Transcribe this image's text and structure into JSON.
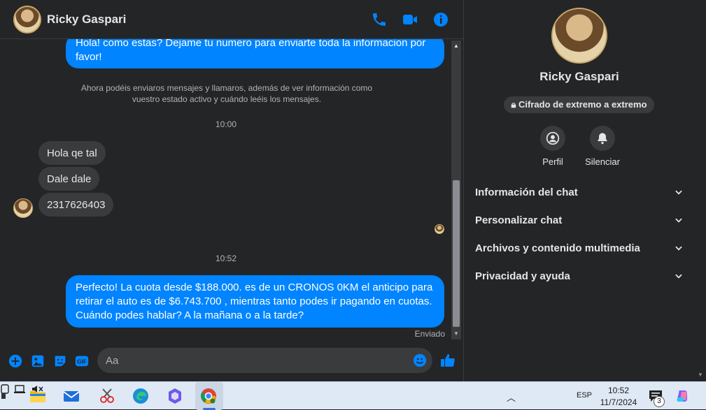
{
  "header": {
    "contact_name": "Ricky Gaspari"
  },
  "messages": {
    "outgoing_1": "Hola! como estas? Dejame tu numero para enviarte toda la informacion por favor!",
    "notice": "Ahora podéis enviaros mensajes y llamaros, además de ver información como vuestro estado activo y cuándo leéis los mensajes.",
    "time_1": "10:00",
    "incoming": [
      "Hola qe tal",
      "Dale dale",
      "2317626403"
    ],
    "time_2": "10:52",
    "outgoing_2": "Perfecto! La cuota desde $188.000. es de un CRONOS 0KM el anticipo para retirar el auto es de $6.743.700 , mientras tanto podes ir pagando en cuotas. Cuándo podes hablar? A la mañana o a la tarde?",
    "status": "Enviado"
  },
  "composer": {
    "placeholder": "Aa"
  },
  "details": {
    "name": "Ricky Gaspari",
    "encryption_badge": "Cifrado de extremo a extremo",
    "actions": {
      "profile": "Perfil",
      "mute": "Silenciar"
    },
    "sections": [
      "Información del chat",
      "Personalizar chat",
      "Archivos y contenido multimedia",
      "Privacidad y ayuda"
    ]
  },
  "taskbar": {
    "language": "ESP",
    "time": "10:52",
    "date": "11/7/2024",
    "notification_count": "3"
  },
  "colors": {
    "accent": "#0084ff",
    "background": "#242526",
    "bubble_incoming": "#3a3b3c"
  }
}
